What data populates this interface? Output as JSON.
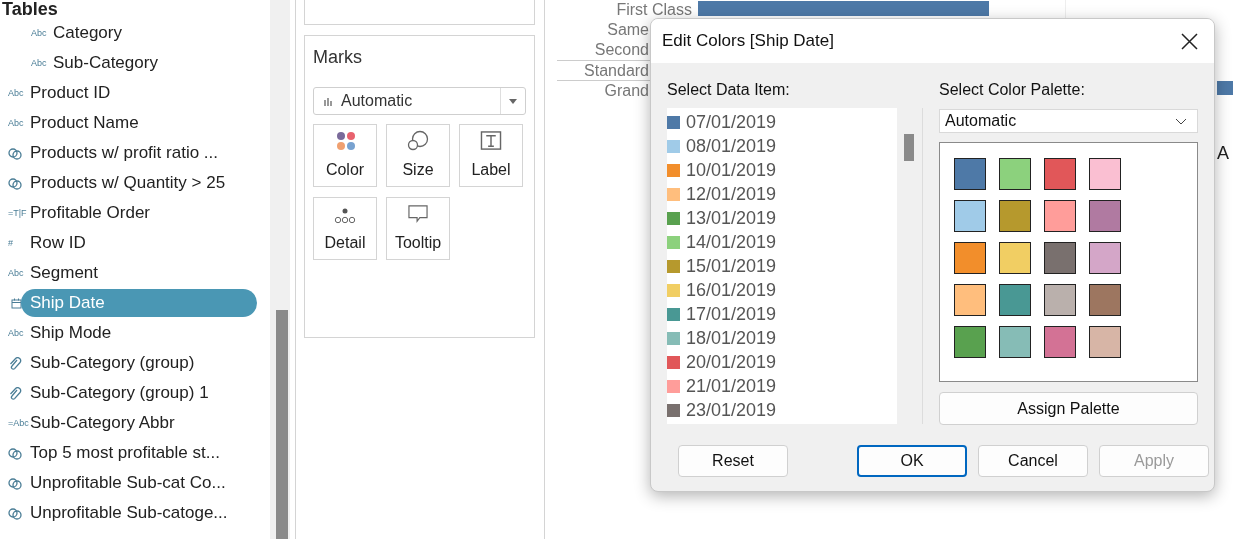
{
  "sidebar": {
    "heading": "Tables",
    "hierarchy_items": [
      {
        "label": "Category",
        "kind": "text",
        "icon_text": "Abc",
        "selected": false
      },
      {
        "label": "Sub-Category",
        "kind": "text",
        "icon_text": "Abc",
        "selected": false
      }
    ],
    "fields": [
      {
        "label": "Product ID",
        "kind": "text",
        "icon_text": "Abc",
        "selected": false
      },
      {
        "label": "Product Name",
        "kind": "text",
        "icon_text": "Abc",
        "selected": false
      },
      {
        "label": "Products w/ profit ratio ...",
        "kind": "set",
        "selected": false
      },
      {
        "label": "Products w/ Quantity > 25",
        "kind": "set",
        "selected": false
      },
      {
        "label": "Profitable Order",
        "kind": "text",
        "icon_text": "=T|F",
        "selected": false
      },
      {
        "label": "Row ID",
        "kind": "text",
        "icon_text": "#",
        "selected": false
      },
      {
        "label": "Segment",
        "kind": "text",
        "icon_text": "Abc",
        "selected": false
      },
      {
        "label": "Ship Date",
        "kind": "date",
        "selected": true
      },
      {
        "label": "Ship Mode",
        "kind": "text",
        "icon_text": "Abc",
        "selected": false
      },
      {
        "label": "Sub-Category (group)",
        "kind": "group",
        "selected": false
      },
      {
        "label": "Sub-Category (group) 1",
        "kind": "group",
        "selected": false
      },
      {
        "label": "Sub-Category Abbr",
        "kind": "text",
        "icon_text": "=Abc",
        "selected": false
      },
      {
        "label": "Top 5 most profitable st...",
        "kind": "set",
        "selected": false
      },
      {
        "label": "Unprofitable Sub-cat Co...",
        "kind": "set",
        "selected": false
      },
      {
        "label": "Unprofitable Sub-catoge...",
        "kind": "set",
        "selected": false
      }
    ]
  },
  "marks": {
    "title": "Marks",
    "mark_type": "Automatic",
    "cards": [
      {
        "label": "Color",
        "kind": "color"
      },
      {
        "label": "Size",
        "kind": "size"
      },
      {
        "label": "Label",
        "kind": "label"
      },
      {
        "label": "Detail",
        "kind": "detail"
      },
      {
        "label": "Tooltip",
        "kind": "tooltip"
      }
    ]
  },
  "view": {
    "row_labels": [
      "First Class",
      "Same",
      "Second",
      "Standard",
      "Grand"
    ],
    "fragment_text": "A"
  },
  "dialog": {
    "title": "Edit Colors [Ship Date]",
    "data_item_label": "Select Data Item:",
    "data_items": [
      {
        "label": "07/01/2019",
        "color": "#4e79a7"
      },
      {
        "label": "08/01/2019",
        "color": "#a0cbe8"
      },
      {
        "label": "10/01/2019",
        "color": "#f28e2b"
      },
      {
        "label": "12/01/2019",
        "color": "#ffbe7d"
      },
      {
        "label": "13/01/2019",
        "color": "#59a14f"
      },
      {
        "label": "14/01/2019",
        "color": "#8cd17d"
      },
      {
        "label": "15/01/2019",
        "color": "#b6992d"
      },
      {
        "label": "16/01/2019",
        "color": "#f1ce63"
      },
      {
        "label": "17/01/2019",
        "color": "#499894"
      },
      {
        "label": "18/01/2019",
        "color": "#86bcb6"
      },
      {
        "label": "20/01/2019",
        "color": "#e15759"
      },
      {
        "label": "21/01/2019",
        "color": "#ff9d9a"
      },
      {
        "label": "23/01/2019",
        "color": "#79706e"
      }
    ],
    "palette_label": "Select Color Palette:",
    "palette": "Automatic",
    "swatches": [
      {
        "color": "#4e79a7"
      },
      {
        "color": "#8cd17d"
      },
      {
        "color": "#e15759"
      },
      {
        "color": "#fabfd2"
      },
      {
        "color": "#a0cbe8"
      },
      {
        "color": "#b6992d"
      },
      {
        "color": "#ff9d9a"
      },
      {
        "color": "#b07aa1"
      },
      {
        "color": "#f28e2b"
      },
      {
        "color": "#f1ce63"
      },
      {
        "color": "#79706e"
      },
      {
        "color": "#d4a6c8"
      },
      {
        "color": "#ffbe7d"
      },
      {
        "color": "#499894"
      },
      {
        "color": "#bab0ac"
      },
      {
        "color": "#9d7660"
      },
      {
        "color": "#59a14f"
      },
      {
        "color": "#86bcb6"
      },
      {
        "color": "#d37295"
      },
      {
        "color": "#d7b5a6"
      }
    ],
    "assign_button": "Assign Palette",
    "buttons": [
      {
        "label": "Reset",
        "kind": "normal",
        "disabled": false
      },
      {
        "label": "OK",
        "kind": "default",
        "disabled": false
      },
      {
        "label": "Cancel",
        "kind": "normal",
        "disabled": false
      },
      {
        "label": "Apply",
        "kind": "normal",
        "disabled": true
      }
    ]
  }
}
